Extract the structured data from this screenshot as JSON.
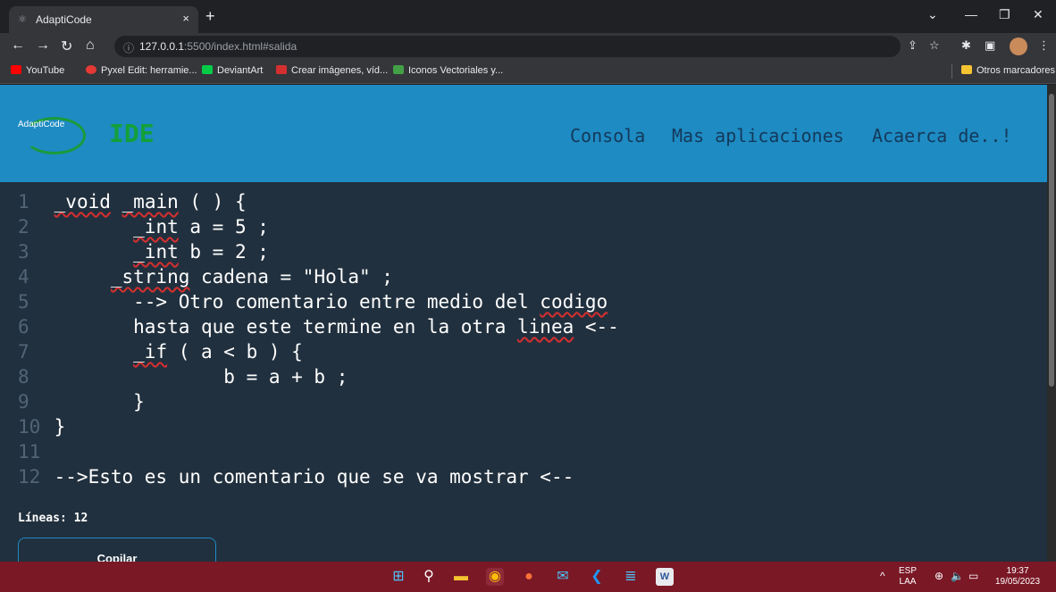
{
  "browser": {
    "tab_title": "AdaptiCode",
    "tab_close": "×",
    "new_tab": "+",
    "url_host": "127.0.0.1",
    "url_rest": ":5500/index.html#salida",
    "bookmarks": [
      {
        "label": "YouTube",
        "color": "#ff0000"
      },
      {
        "label": "Pyxel Edit: herramie...",
        "color": "#e53935"
      },
      {
        "label": "DeviantArt",
        "color": "#05cc47"
      },
      {
        "label": "Crear imágenes, víd...",
        "color": "#d32f2f"
      },
      {
        "label": "Iconos Vectoriales y...",
        "color": "#43a047"
      }
    ],
    "other_bookmarks": "Otros marcadores"
  },
  "header": {
    "logo_text": "AdaptiCode",
    "app_title": "IDE",
    "menu": [
      "Consola",
      "Mas aplicaciones",
      "Acaerca de..!"
    ]
  },
  "editor": {
    "lines": [
      {
        "num": "1",
        "pre": " ",
        "kw1": "_void",
        "mid": " ",
        "kw2": "_main",
        "post": " ( ) {"
      },
      {
        "num": "2",
        "pre": "        ",
        "kw1": "_int",
        "mid": "",
        "kw2": "",
        "post": " a = 5 ;"
      },
      {
        "num": "3",
        "pre": "        ",
        "kw1": "_int",
        "mid": "",
        "kw2": "",
        "post": " b = 2 ;"
      },
      {
        "num": "4",
        "pre": "      ",
        "kw1": "_string",
        "mid": "",
        "kw2": "",
        "post": " cadena = \"Hola\" ;"
      },
      {
        "num": "5",
        "pre": "        --> Otro comentario entre medio del ",
        "kw1": "codigo",
        "mid": "",
        "kw2": "",
        "post": ""
      },
      {
        "num": "6",
        "pre": "        hasta que este termine en la otra ",
        "kw1": "linea",
        "mid": "",
        "kw2": "",
        "post": " <--"
      },
      {
        "num": "7",
        "pre": "        ",
        "kw1": "_if",
        "mid": "",
        "kw2": "",
        "post": " ( a < b ) {"
      },
      {
        "num": "8",
        "pre": "                b = a + b ;",
        "kw1": "",
        "mid": "",
        "kw2": "",
        "post": ""
      },
      {
        "num": "9",
        "pre": "        }",
        "kw1": "",
        "mid": "",
        "kw2": "",
        "post": ""
      },
      {
        "num": "10",
        "pre": " }",
        "kw1": "",
        "mid": "",
        "kw2": "",
        "post": ""
      },
      {
        "num": "11",
        "pre": "",
        "kw1": "",
        "mid": "",
        "kw2": "",
        "post": ""
      },
      {
        "num": "12",
        "pre": " -->Esto es un comentario que se va mostrar <--",
        "kw1": "",
        "mid": "",
        "kw2": "",
        "post": ""
      }
    ],
    "lines_count": "Líneas: 12",
    "copy_label": "Copilar"
  },
  "taskbar": {
    "lang_top": "ESP",
    "lang_bottom": "LAA",
    "time": "19:37",
    "date": "19/05/2023"
  }
}
